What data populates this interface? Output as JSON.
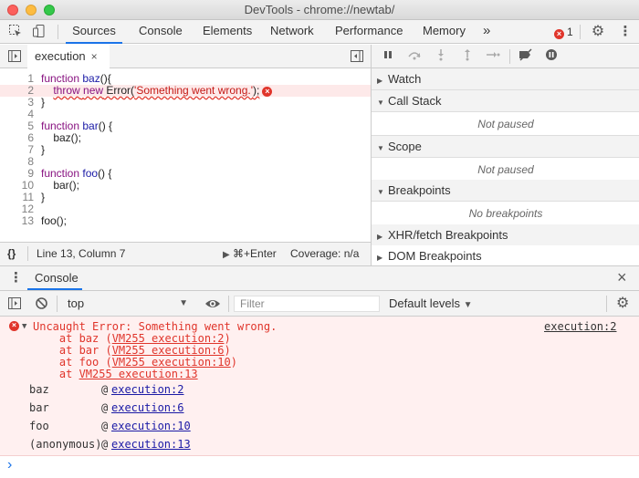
{
  "window": {
    "title": "DevTools - chrome://newtab/"
  },
  "main_tabs": [
    {
      "label": "Sources",
      "active": true
    },
    {
      "label": "Console"
    },
    {
      "label": "Elements"
    },
    {
      "label": "Network"
    },
    {
      "label": "Performance"
    },
    {
      "label": "Memory"
    }
  ],
  "more_tabs": "»",
  "error_count": "1",
  "file_tab": {
    "name": "execution",
    "close": "×"
  },
  "code_lines": [
    {
      "n": "1",
      "text": "function baz(){"
    },
    {
      "n": "2",
      "text": "throw new Error('Something went wrong.');"
    },
    {
      "n": "3",
      "text": "}"
    },
    {
      "n": "4",
      "text": ""
    },
    {
      "n": "5",
      "text": "function bar() {"
    },
    {
      "n": "6",
      "text": "    baz();"
    },
    {
      "n": "7",
      "text": "}"
    },
    {
      "n": "8",
      "text": ""
    },
    {
      "n": "9",
      "text": "function foo() {"
    },
    {
      "n": "10",
      "text": "    bar();"
    },
    {
      "n": "11",
      "text": "}"
    },
    {
      "n": "12",
      "text": ""
    },
    {
      "n": "13",
      "text": "foo();"
    }
  ],
  "status": {
    "format": "{}",
    "position": "Line 13, Column 7",
    "run": "⌘+Enter",
    "coverage": "Coverage: n/a"
  },
  "sections": {
    "watch": "Watch",
    "call_stack": "Call Stack",
    "call_stack_body": "Not paused",
    "scope": "Scope",
    "scope_body": "Not paused",
    "breakpoints": "Breakpoints",
    "breakpoints_body": "No breakpoints",
    "xhr": "XHR/fetch Breakpoints",
    "dom": "DOM Breakpoints"
  },
  "drawer": {
    "tab": "Console"
  },
  "console_toolbar": {
    "context": "top",
    "filter_placeholder": "Filter",
    "levels": "Default levels"
  },
  "error": {
    "message": "Uncaught Error: Something went wrong.",
    "source": "execution:2",
    "trace": [
      {
        "prefix": "    at baz (",
        "link": "VM255 execution:2",
        "suffix": ")"
      },
      {
        "prefix": "    at bar (",
        "link": "VM255 execution:6",
        "suffix": ")"
      },
      {
        "prefix": "    at foo (",
        "link": "VM255 execution:10",
        "suffix": ")"
      },
      {
        "prefix": "    at ",
        "link": "VM255 execution:13",
        "suffix": ""
      }
    ],
    "stack": [
      {
        "fn": "baz",
        "at": "@",
        "link": "execution:2"
      },
      {
        "fn": "bar",
        "at": "@",
        "link": "execution:6"
      },
      {
        "fn": "foo",
        "at": "@",
        "link": "execution:10"
      },
      {
        "fn": "(anonymous)",
        "at": "@",
        "link": "execution:13"
      }
    ]
  },
  "prompt_symbol": "›"
}
